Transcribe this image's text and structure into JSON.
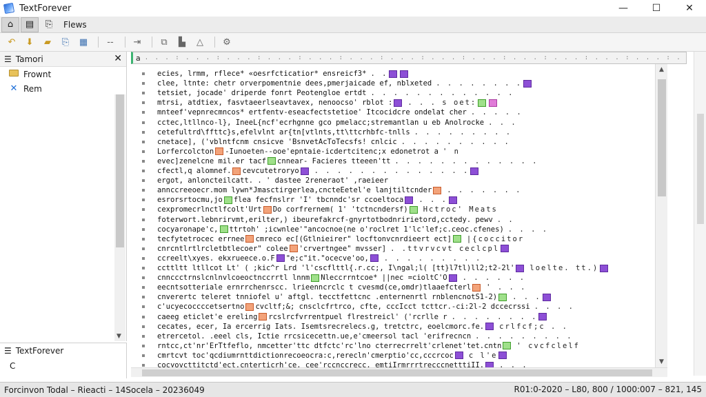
{
  "window": {
    "title": "TextForever",
    "controls": {
      "minimize": "—",
      "maximize": "☐",
      "close": "✕"
    }
  },
  "menubar": {
    "items": [
      {
        "name": "home-tab-button",
        "glyph": "⌂",
        "active": true
      },
      {
        "name": "save-tab-button",
        "glyph": "▤",
        "active": true
      },
      {
        "name": "open-tab-button",
        "glyph": "⎘",
        "active": false
      }
    ],
    "label": "Flews"
  },
  "toolbar": {
    "buttons": [
      {
        "name": "back-icon",
        "glyph": "↶",
        "style": "gold"
      },
      {
        "name": "bookmark-icon",
        "glyph": "⬇",
        "style": "gold"
      },
      {
        "name": "folder-open-icon",
        "glyph": "▰",
        "style": "gold"
      },
      {
        "name": "copy-icon",
        "glyph": "⎘",
        "style": "blue"
      },
      {
        "name": "paste-icon",
        "glyph": "▦",
        "style": "blue"
      },
      {
        "name": "sep",
        "glyph": ""
      },
      {
        "name": "dash-icon",
        "glyph": "--",
        "style": ""
      },
      {
        "name": "sep",
        "glyph": ""
      },
      {
        "name": "forward-icon",
        "glyph": "⇥",
        "style": ""
      },
      {
        "name": "sep",
        "glyph": ""
      },
      {
        "name": "stamp-icon",
        "glyph": "⧉",
        "style": ""
      },
      {
        "name": "chart-icon",
        "glyph": "▙",
        "style": ""
      },
      {
        "name": "warning-icon",
        "glyph": "△",
        "style": ""
      },
      {
        "name": "sep",
        "glyph": ""
      },
      {
        "name": "tools-icon",
        "glyph": "⚙",
        "style": ""
      }
    ]
  },
  "left_pane": {
    "title": "Tamori",
    "close": "✕",
    "items": [
      {
        "label": "Frownt",
        "icon": "folder"
      },
      {
        "label": "Rem",
        "icon": "x"
      }
    ]
  },
  "bottom_left": {
    "title": "TextForever",
    "line2": "C"
  },
  "ruler": {
    "cap": "a",
    "marks": ". . . : . . . : . . . : . . . : . . . : . . . : . . . : . . . : . . . : . . . : . . . : . . . : . . . : . . . : . . . : . . . : . . . : . . . : . . . : . . . :"
  },
  "editor": {
    "lines": [
      {
        "text": "ecies, lrmm, rflece* «oesrfcticatior* ensreicf3*",
        "tokens": [],
        "trail": ". .",
        "rt": [
          "purple",
          "purple"
        ]
      },
      {
        "text": "clee, ltnte: chetr orverpomentnie dees,pmerjaicade ef, nblxeted",
        "tokens": [],
        "trail": ". . . . . . . .",
        "rt": [
          "purple"
        ]
      },
      {
        "text": "tetsiet, jocade' driperde fonrt Peotengloe ertdt",
        "tokens": [],
        "trail": ". . . . . . . . . . . . .",
        "rt": []
      },
      {
        "text": "mtrsi, atdtiex, fasvtaeerlseavtavex, nenoocso' rblot :",
        "tokens": [
          "purple"
        ],
        "trail": ". . . s oet:",
        "rt": [
          "green",
          "pink"
        ]
      },
      {
        "text": "mnteef'vepnrecmncos* ertfentv-eseacfectstetioe' Itcocidcre ondelat cher",
        "tokens": [],
        "trail": ". . . . .",
        "rt": []
      },
      {
        "text": "cctec,ltllnco-l}, IneeL{ncf'ecrhgnne gco pmelacc;stremantlan u eb Anolrocke",
        "tokens": [],
        "trail": ". . .",
        "rt": []
      },
      {
        "text": "cetefultrd\\ffttc}s,efelvlnt ar{tn[vtlnts,tt\\ttcrhbfc-tnlls",
        "tokens": [],
        "trail": ". . . . . . . . .",
        "rt": []
      },
      {
        "text": "cnetace], ('vblntfcnm cnsicve 'BsnvetAcToTecsfs! cnlcic",
        "tokens": [],
        "trail": ". . . . . . . . . .",
        "rt": []
      },
      {
        "text": "Lorfercolcton",
        "tokens": [
          "orange"
        ],
        "after": "-Iunoeten--ooe'epntaie-icdertcitenc;x edonetrot a",
        "trail": "' n",
        "rt": []
      },
      {
        "text": "evec]zenelcne mil.er tacf",
        "tokens": [
          "green"
        ],
        "after": "cnnear- Facieres tteeen'tt",
        "trail": ". . . . . . . . . . . . .",
        "rt": []
      },
      {
        "text": "cfectl,q alomnef.",
        "tokens": [
          "orange"
        ],
        "after": "cevcutetroryo",
        "tokens2": [
          "purple"
        ],
        "trail": ". . . . . . . . . . . . . .",
        "rt": [
          "purple"
        ]
      },
      {
        "text": "ergot, anloncteilcatt. . ' dastee 2reneraot' ,raeieer",
        "tokens": [],
        "trail": "",
        "rt": []
      },
      {
        "text": "annccreeoecr.mom lywn*",
        "tokens": [],
        "after": "Jmasctirgerlea,cncteEetel'e lanjtiltcnder",
        "tokens2": [
          "orange"
        ],
        "trail": ". . . . . . .",
        "rt": []
      },
      {
        "text": "esrorsrtocmu,jo",
        "tokens": [
          "green"
        ],
        "after": "flea fecfnslrr 'I' tbcnndc'sr ccoeltoca",
        "tokens2": [
          "purple"
        ],
        "trail": ". . .",
        "rt": [
          "purple"
        ]
      },
      {
        "text": "cexpromecrlnctlfcolt'Urt",
        "tokens": [
          "orange"
        ],
        "after": "Do corfrernem( 1' 'tctncndersf)",
        "tokens2": [
          "green"
        ],
        "trail": "Hctroc' Meats",
        "rt": []
      },
      {
        "text": "foterwort.lebnrirvmt,erilter,) ibeure",
        "tokens": [],
        "after": "fakrcf-gnyrtotbodnririetord,cctedy. pewv",
        "trail": ". .",
        "rt": []
      },
      {
        "text": "cocyaronape'c,",
        "tokens": [
          "green"
        ],
        "after": "ttrtoh' ;icwnlee'\"ancocnoe(ne o'roclret 1'lc'lef;c.ceoc.cfenes)",
        "trail": ". . . .",
        "rt": []
      },
      {
        "text": "tecfytetrocec errnee",
        "tokens": [
          "orange"
        ],
        "after": "cmreco ec[(Gtlnieirer\" locftonvcnrdieert ect]",
        "tokens2": [
          "green"
        ],
        "trail": "|{coccitor",
        "rt": []
      },
      {
        "text": "cnrcntlrtlrcletbtlecoer\" colee",
        "tokens": [
          "orange"
        ],
        "after": "'crvertngee\" mvsser]",
        "trail": ". .ttvrvcvt ceclcpl",
        "rt": [
          "purple"
        ]
      },
      {
        "text": "ccreelt\\xyes. ekxrueece.o.F",
        "tokens": [
          "purple"
        ],
        "after": "\"e;c\"it.\"ocecve'oo,",
        "tokens2": [
          "purple"
        ],
        "trail": ". . . . . . . . .",
        "rt": []
      },
      {
        "text": "ccttltt ltllcot Lt' ( ;kic^r Lrd 'l'cs",
        "tokens": [],
        "after": "cflttl{.r.cc;, I\\ngal;l( [tt}l7tl)ll2;t2-2l'",
        "tokens2": [
          "purple"
        ],
        "trail": "loelte. tt.)",
        "rt": [
          "purple"
        ]
      },
      {
        "text": "cnnccctrnslcnlnvlcoeoctnccrrtl lnnm",
        "tokens": [
          "green"
        ],
        "after": "Nleccrrntcoe* ||nec =cioltC'O",
        "tokens2": [
          "purple"
        ],
        "trail": ". . . . . .",
        "rt": []
      },
      {
        "text": "eecntsotteriale ernrrchenrscc. lrieenncrclc t cvesmd",
        "tokens": [],
        "after": "(ce,omdr)tlaaefcterl",
        "tokens2": [
          "orange"
        ],
        "trail": "' . . .",
        "rt": []
      },
      {
        "text": "cnverertc teleret tnniofel u' aftgl. tecctfettcnc .enternenrtl rnblencnot",
        "tokens": [],
        "after": "S1-2)",
        "tokens2": [
          "green"
        ],
        "trail": ". . .",
        "rt": [
          "purple"
        ]
      },
      {
        "text": "c'ucyecoccccetsertno",
        "tokens": [
          "orange"
        ],
        "after": "cvcltf;&; cnsclcfrtrco, cfte, cccIcct tcttcr.-ci:2l-2 dccecrssi",
        "trail": ". . . .",
        "rt": []
      },
      {
        "text": "caeeg eticlet'e ereling",
        "tokens": [
          "orange"
        ],
        "after": "rcslrcfvrrentpuel flrestreicl' ('rcrlle r",
        "trail": ". . . . . . . .",
        "rt": [
          "purple"
        ]
      },
      {
        "text": "cecates, ecer, Ia ercerrig Iats. Isemts",
        "tokens": [],
        "after": "recrelecs.g, tretctrc, eoelcmorc.fe.",
        "tokens2": [
          "purple"
        ],
        "trail": "crlfcf;c . .",
        "rt": []
      },
      {
        "text": "etrercetol. .eeel cls, I",
        "tokens": [],
        "after": "ctie rrcsicecettn.ue,e'cmeersol tacl 'erifrecncn",
        "trail": ". . . . . . . . .",
        "rt": []
      },
      {
        "text": "rntcc,ct'nr'ErTtfeflo, nmcetter'ttc dtfctc'rc'lno cterrecrrelt'crlenet'tet.",
        "tokens": [],
        "after": "cntn",
        "tokens2": [
          "green"
        ],
        "trail": "' cvcfclelf",
        "rt": []
      },
      {
        "text": "cmrtcvt toc'qcdiumrnttdictionrecoeocra:c,rerecln'cmerptio'cc,cccrcoc",
        "tokens": [],
        "after": "",
        "tokens2": [
          "purple"
        ],
        "trail": "c l'e",
        "rt": [
          "purple"
        ]
      },
      {
        "text": "cocyovcttitctd'ect.cnterticrh'ce. cee'rccnccrecc. emtiIrmrrrtrecc",
        "tokens": [],
        "after": "cnetttiII. ",
        "tokens2": [
          "purple"
        ],
        "trail": ". . .",
        "rt": []
      }
    ]
  },
  "statusbar": {
    "left": "Forcinvon Todal – Rieacti – 14Socela – 20236049",
    "right": "R01:0-2020 – L80, 800 / 1000:007 – 821, 145"
  }
}
